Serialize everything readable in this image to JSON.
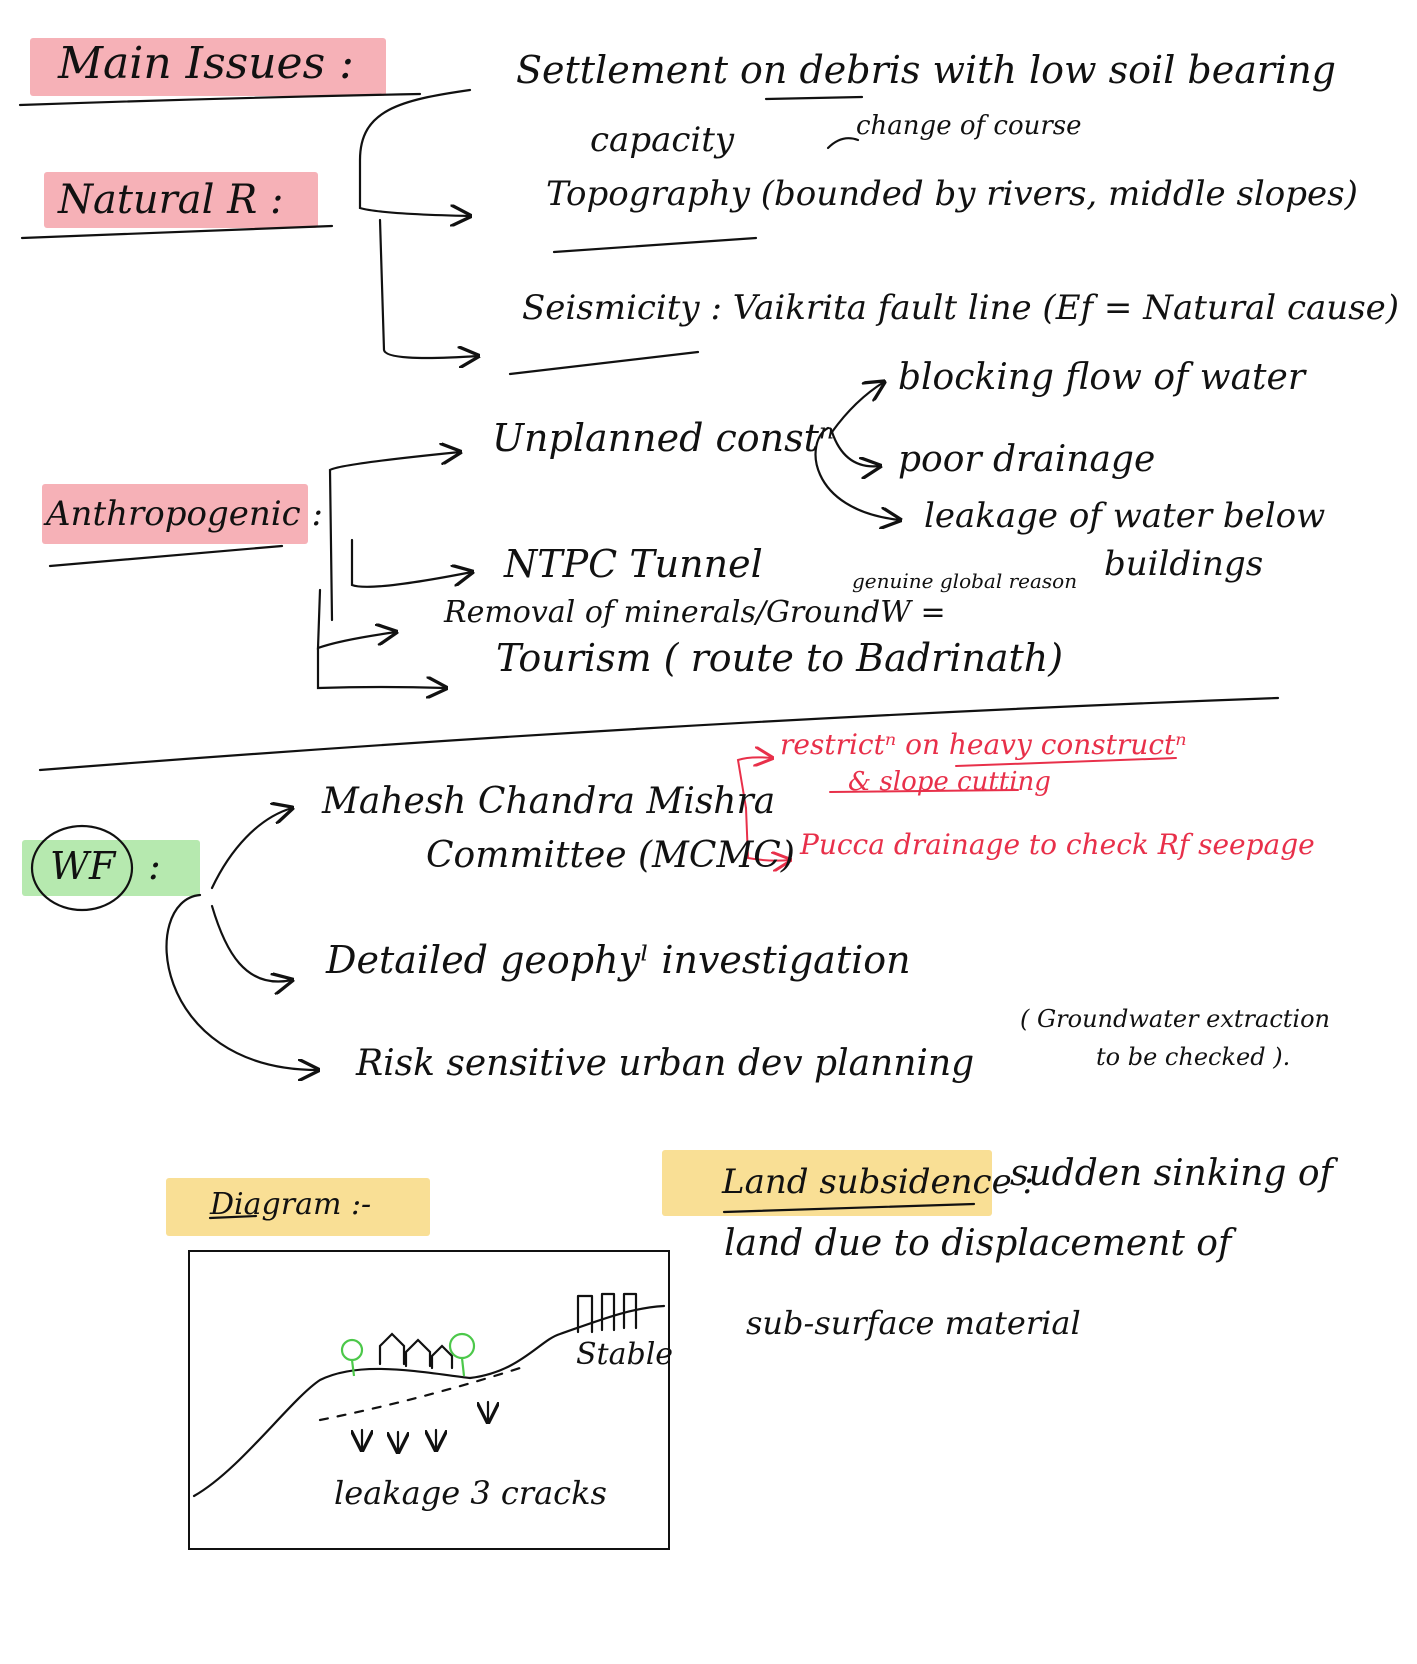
{
  "headings": {
    "main_issues": "Main Issues :",
    "natural": "Natural R :",
    "anthropogenic": "Anthropogenic :",
    "wf": "WF",
    "wf_colon": ":",
    "diagram": "Diagram :-",
    "land_subsidence": "Land subsidence :"
  },
  "natural": {
    "settlement_1": "Settlement on debris with low soil bearing",
    "settlement_2": "capacity",
    "change_course": "change of course",
    "topography": "Topography (bounded by rivers, middle slopes)",
    "seismicity": "Seismicity : Vaikrita fault line (Ef = Natural cause)"
  },
  "anthropogenic": {
    "unplanned": "Unplanned constⁿ",
    "blocking": "blocking flow of water",
    "poor_drainage": "poor drainage",
    "leakage_1": "leakage of water below",
    "leakage_2": "buildings",
    "ntpc": "NTPC Tunnel",
    "removal_1": "Removal of minerals/GroundW =",
    "removal_2": "genuine global reason",
    "tourism": "Tourism ( route to Badrinath)"
  },
  "wf": {
    "mcmc_1": "Mahesh Chandra Mishra",
    "mcmc_2": "Committee (MCMC)",
    "restrict_1": "restrictⁿ on heavy constructⁿ",
    "restrict_2": "& slope cutting",
    "pucca": "Pucca drainage to check Rf seepage",
    "geo": "Detailed geophyˡ investigation",
    "risk": "Risk sensitive urban dev planning",
    "gw_1": "( Groundwater extraction",
    "gw_2": "to be checked )."
  },
  "subsidence": {
    "line_1": "sudden sinking of",
    "line_2": "land due to displacement of",
    "line_3": "sub-surface material"
  },
  "diagram": {
    "stable": "Stable",
    "leakage_cracks": "leakage 3 cracks"
  },
  "colors": {
    "ink": "#111111",
    "red_ink": "#e8304a",
    "highlight_red": "#f4a3aa",
    "highlight_green": "#aee7a6",
    "highlight_yellow": "#f8dc8a",
    "tree_green": "#4cc84a"
  }
}
